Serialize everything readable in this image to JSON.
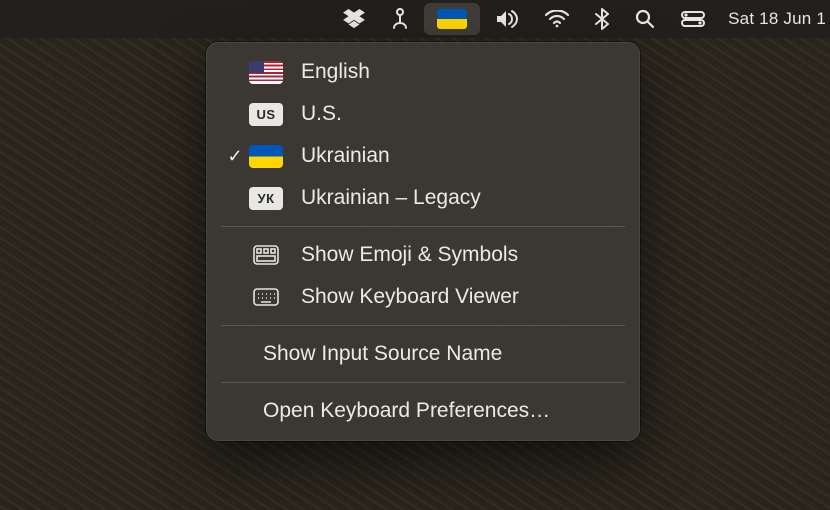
{
  "menubar": {
    "clock": "Sat 18 Jun  1"
  },
  "menu": {
    "items": [
      {
        "label": "English",
        "badge_kind": "us-flag",
        "checked": false
      },
      {
        "label": "U.S.",
        "badge_kind": "us-badge",
        "badge_text": "US",
        "checked": false
      },
      {
        "label": "Ukrainian",
        "badge_kind": "ua-flag",
        "checked": true
      },
      {
        "label": "Ukrainian – Legacy",
        "badge_kind": "uk-badge",
        "badge_text": "УК",
        "checked": false
      }
    ],
    "emoji": "Show Emoji & Symbols",
    "viewer": "Show Keyboard Viewer",
    "showname": "Show Input Source Name",
    "prefs": "Open Keyboard Preferences…"
  }
}
